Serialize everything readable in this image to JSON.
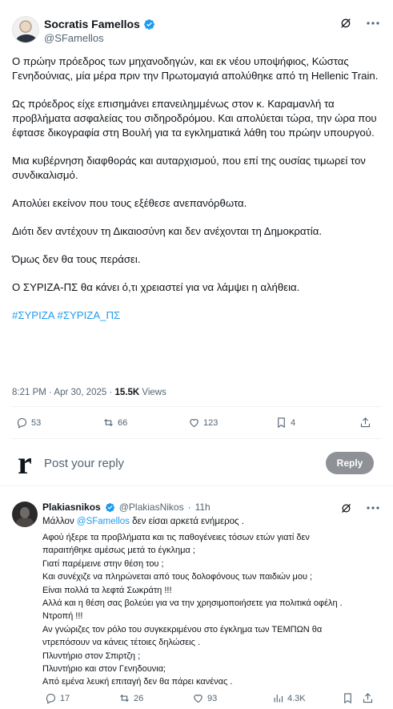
{
  "main_tweet": {
    "display_name": "Socratis Famellos",
    "handle": "@SFamellos",
    "paragraphs": [
      "Ο πρώην πρόεδρος των μηχανοδηγών, και εκ νέου υποψήφιος, Κώστας Γενηδούνιας, μία μέρα πριν την Πρωτομαγιά απολύθηκε από τη Hellenic Train.",
      "Ως πρόεδρος είχε επισημάνει επανειλημμένως στον κ. Καραμανλή τα προβλήματα ασφαλείας του σιδηροδρόμου. Και απολύεται τώρα, την ώρα που έφτασε δικογραφία στη Βουλή για τα εγκληματικά λάθη του πρώην υπουργού.",
      "Μια κυβέρνηση διαφθοράς και αυταρχισμού, που επί της ουσίας τιμωρεί τον συνδικαλισμό.",
      "Απολύει εκείνον που τους εξέθεσε ανεπανόρθωτα.",
      "Διότι δεν αντέχουν τη Δικαιοσύνη και δεν ανέχονται τη Δημοκρατία.",
      "Όμως δεν θα τους περάσει.",
      "Ο ΣΥΡΙΖΑ-ΠΣ θα κάνει ό,τι χρειαστεί για να λάμψει η αλήθεια."
    ],
    "hashtags": "#ΣΥΡΙΖΑ #ΣΥΡΙΖΑ_ΠΣ",
    "timestamp": "8:21 PM · Apr 30, 2025 · ",
    "views_count": "15.5K",
    "views_label": " Views",
    "actions": {
      "replies": "53",
      "reposts": "66",
      "likes": "123",
      "bookmarks": "4"
    }
  },
  "reply_box": {
    "logo_letter": "r",
    "placeholder": "Post your reply",
    "button_label": "Reply"
  },
  "reply_tweet": {
    "display_name": "Plakiasnikos",
    "handle": "@PlakiasNikos",
    "separator": "·",
    "time": "11h",
    "text_before_mention": "Μάλλον ",
    "mention": "@SFamellos",
    "text_after_mention": " δεν είσαι αρκετά ενήμερος .",
    "lines": [
      "Αφού ήξερε τα προβλήματα και τις παθογένειες τόσων ετών γιατί δεν",
      "παραιτήθηκε αμέσως μετά το έγκλημα ;",
      "Γιατί παρέμεινε στην θέση του ;",
      "Και συνέχιζε να πληρώνεται από τους δολοφόνους των παιδιών μου ;",
      "Είναι πολλά τα λεφτά Σωκράτη !!!",
      "Αλλά και η θέση σας βολεύει για να την χρησιμοποιήσετε για πολιτικά οφέλη .",
      "Ντροπή !!!",
      "Αν γνώριζες τον ρόλο του συγκεκριμένου στο έγκλημα των ΤΕΜΠΩΝ θα",
      "ντρεπόσουν να κάνεις τέτοιες δηλώσεις .",
      "Πλυντήριο στον Σπιρτζη ;",
      "Πλυντήριο και στον Γενηδουνια;",
      "Από εμένα λευκή επιταγή δεν θα πάρει κανένας ."
    ],
    "actions": {
      "replies": "17",
      "reposts": "26",
      "likes": "93",
      "views": "4.3K"
    }
  },
  "icons": {
    "verified": "verified-badge-icon",
    "grok": "grok-icon",
    "more": "more-icon",
    "reply": "reply-icon",
    "repost": "repost-icon",
    "like": "like-icon",
    "bookmark": "bookmark-icon",
    "share": "share-icon",
    "analytics": "analytics-icon"
  },
  "colors": {
    "accent": "#1d9bf0",
    "text_primary": "#0f1419",
    "text_secondary": "#536471",
    "reply_button_bg": "#8e9196"
  }
}
